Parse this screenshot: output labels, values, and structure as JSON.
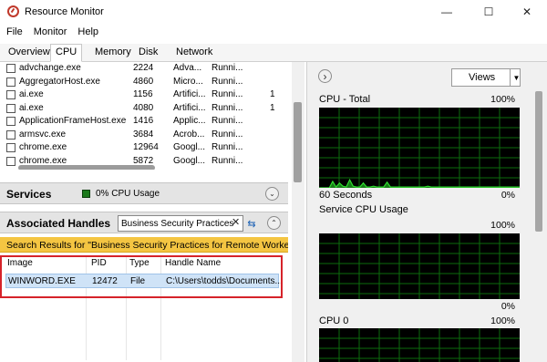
{
  "window": {
    "title": "Resource Monitor",
    "minimize": "—",
    "maximize": "☐",
    "close": "✕"
  },
  "menu": [
    {
      "label": "File"
    },
    {
      "label": "Monitor"
    },
    {
      "label": "Help"
    }
  ],
  "tabs": [
    {
      "label": "Overview"
    },
    {
      "label": "CPU"
    },
    {
      "label": "Memory"
    },
    {
      "label": "Disk"
    },
    {
      "label": "Network"
    }
  ],
  "active_tab": "CPU",
  "processes": [
    {
      "name": "advchange.exe",
      "pid": "2224",
      "desc": "Adva...",
      "status": "Runni...",
      "extra": ""
    },
    {
      "name": "AggregatorHost.exe",
      "pid": "4860",
      "desc": "Micro...",
      "status": "Runni...",
      "extra": ""
    },
    {
      "name": "ai.exe",
      "pid": "1156",
      "desc": "Artifici...",
      "status": "Runni...",
      "extra": "1"
    },
    {
      "name": "ai.exe",
      "pid": "4080",
      "desc": "Artifici...",
      "status": "Runni...",
      "extra": "1"
    },
    {
      "name": "ApplicationFrameHost.exe",
      "pid": "1416",
      "desc": "Applic...",
      "status": "Runni...",
      "extra": ""
    },
    {
      "name": "armsvc.exe",
      "pid": "3684",
      "desc": "Acrob...",
      "status": "Runni...",
      "extra": ""
    },
    {
      "name": "chrome.exe",
      "pid": "12964",
      "desc": "Googl...",
      "status": "Runni...",
      "extra": ""
    },
    {
      "name": "chrome.exe",
      "pid": "5872",
      "desc": "Googl...",
      "status": "Runni...",
      "extra": ""
    }
  ],
  "services": {
    "title": "Services",
    "cpu_usage": "0% CPU Usage",
    "chevron": "⌄"
  },
  "handles": {
    "title": "Associated Handles",
    "search_value": "Business Security Practices",
    "clear_icon": "✕",
    "search_icon": "⇆",
    "chevron": "⌃",
    "results_text": "Search Results for \"Business Security Practices for Remote Workers...",
    "columns": [
      "Image",
      "PID",
      "Type",
      "Handle Name"
    ],
    "rows": [
      {
        "image": "WINWORD.EXE",
        "pid": "12472",
        "type": "File",
        "handle": "C:\\Users\\todds\\Documents..."
      }
    ]
  },
  "right_panel": {
    "expand_icon": "›",
    "views_label": "Views",
    "views_dropdown": "▼",
    "graphs": [
      {
        "title": "CPU - Total",
        "max": "100%",
        "footer_left": "60 Seconds",
        "footer_right": "0%"
      },
      {
        "title": "Service CPU Usage",
        "max": "100%",
        "footer_left": "",
        "footer_right": "0%"
      },
      {
        "title": "CPU 0",
        "max": "100%",
        "footer_left": "",
        "footer_right": ""
      }
    ]
  },
  "cpu_total_series": [
    0,
    0,
    0,
    0,
    8,
    1,
    6,
    2,
    1,
    10,
    2,
    1,
    1,
    6,
    1,
    1,
    2,
    1,
    1,
    1,
    7,
    1,
    1,
    1,
    1,
    1,
    1,
    1,
    1,
    1,
    1,
    1,
    2,
    1,
    1,
    1,
    1,
    1,
    1,
    1,
    1,
    1,
    1,
    1,
    1,
    1,
    1,
    1,
    1,
    1,
    1,
    1,
    1,
    1,
    1,
    1,
    1,
    1,
    1,
    1
  ],
  "colors": {
    "graph_bg": "#000000",
    "grid": "#0d6b0d",
    "line": "#2fdc2f",
    "fill": "#1f9a1f",
    "highlight": "#f4c542",
    "selection": "#cfe3f7",
    "annotation": "#d6232a"
  }
}
